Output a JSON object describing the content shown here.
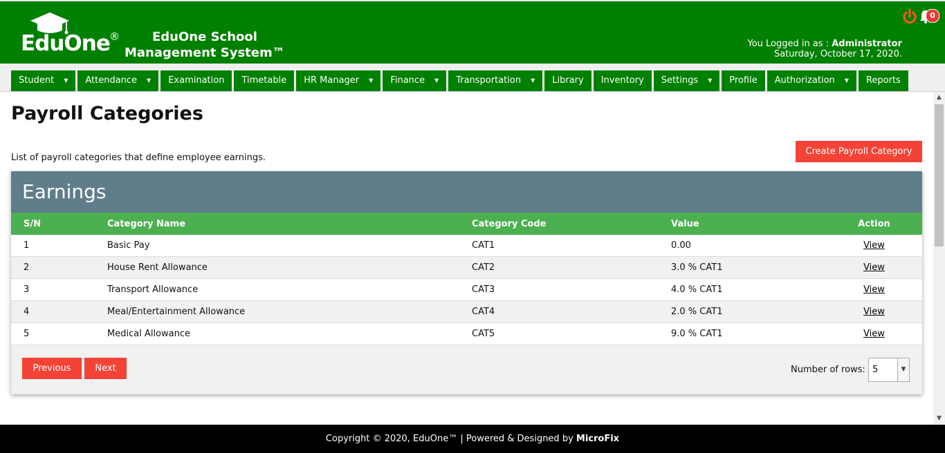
{
  "header": {
    "logo_text": "EduOne",
    "logo_reg": "®",
    "school_line1": "EduOne School",
    "school_line2": "Management System™",
    "login_prefix": "You Logged in as : ",
    "login_user": "Administrator",
    "date": "Saturday, October 17, 2020.",
    "notification_count": "0",
    "power_icon": "power-icon",
    "bell_icon": "bell-icon"
  },
  "nav": {
    "items": [
      {
        "label": "Student",
        "dropdown": true
      },
      {
        "label": "Attendance",
        "dropdown": true
      },
      {
        "label": "Examination",
        "dropdown": false
      },
      {
        "label": "Timetable",
        "dropdown": false
      },
      {
        "label": "HR Manager",
        "dropdown": true
      },
      {
        "label": "Finance",
        "dropdown": true
      },
      {
        "label": "Transportation",
        "dropdown": true
      },
      {
        "label": "Library",
        "dropdown": false
      },
      {
        "label": "Inventory",
        "dropdown": false
      },
      {
        "label": "Settings",
        "dropdown": true
      },
      {
        "label": "Profile",
        "dropdown": false
      },
      {
        "label": "Authorization",
        "dropdown": true
      },
      {
        "label": "Reports",
        "dropdown": false
      }
    ],
    "caret": "▼"
  },
  "page": {
    "title": "Payroll Categories",
    "description": "List of payroll categories that define employee earnings.",
    "create_button": "Create Payroll Category"
  },
  "earnings": {
    "heading": "Earnings",
    "columns": {
      "sn": "S/N",
      "name": "Category Name",
      "code": "Category Code",
      "value": "Value",
      "action": "Action"
    },
    "rows": [
      {
        "sn": "1",
        "name": "Basic Pay",
        "code": "CAT1",
        "value": "0.00",
        "action": "View"
      },
      {
        "sn": "2",
        "name": "House Rent Allowance",
        "code": "CAT2",
        "value": "3.0 % CAT1",
        "action": "View"
      },
      {
        "sn": "3",
        "name": "Transport Allowance",
        "code": "CAT3",
        "value": "4.0 % CAT1",
        "action": "View"
      },
      {
        "sn": "4",
        "name": "Meal/Entertainment Allowance",
        "code": "CAT4",
        "value": "2.0 % CAT1",
        "action": "View"
      },
      {
        "sn": "5",
        "name": "Medical Allowance",
        "code": "CAT5",
        "value": "9.0 % CAT1",
        "action": "View"
      }
    ]
  },
  "pagination": {
    "previous": "Previous",
    "next": "Next",
    "rows_label": "Number of rows:",
    "rows_value": "5"
  },
  "footer": {
    "text": "Copyright © 2020, EduOne™ | Powered & Designed by ",
    "brand": "MicroFix"
  },
  "colors": {
    "header_green": "#008000",
    "table_header_green": "#4caf50",
    "card_header_slate": "#607d8b",
    "accent_red": "#f44336"
  }
}
